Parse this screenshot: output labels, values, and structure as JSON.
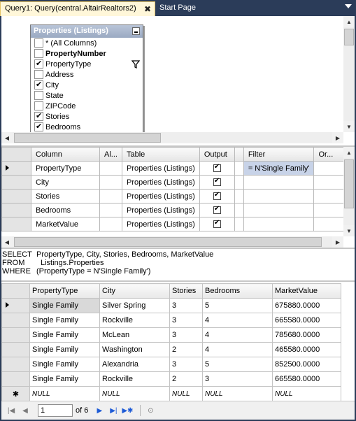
{
  "tabs": {
    "active_label": "Query1: Query(central.AltairRealtors2)",
    "close_glyph": "✖",
    "inactive_label": "Start Page"
  },
  "diagram": {
    "table_title": "Properties (Listings)",
    "columns": [
      {
        "label": "* (All Columns)",
        "checked": false,
        "bold": false
      },
      {
        "label": "PropertyNumber",
        "checked": false,
        "bold": true
      },
      {
        "label": "PropertyType",
        "checked": true,
        "bold": false,
        "filter_icon": "funnel-icon"
      },
      {
        "label": "Address",
        "checked": false,
        "bold": false
      },
      {
        "label": "City",
        "checked": true,
        "bold": false
      },
      {
        "label": "State",
        "checked": false,
        "bold": false
      },
      {
        "label": "ZIPCode",
        "checked": false,
        "bold": false
      },
      {
        "label": "Stories",
        "checked": true,
        "bold": false
      },
      {
        "label": "Bedrooms",
        "checked": true,
        "bold": false
      }
    ]
  },
  "criteria": {
    "headers": [
      "Column",
      "Al...",
      "Table",
      "Output",
      "",
      "Filter",
      "Or..."
    ],
    "rows": [
      {
        "column": "PropertyType",
        "alias": "",
        "table": "Properties (Listings)",
        "output": true,
        "filter": "= N'Single Family'"
      },
      {
        "column": "City",
        "alias": "",
        "table": "Properties (Listings)",
        "output": true,
        "filter": ""
      },
      {
        "column": "Stories",
        "alias": "",
        "table": "Properties (Listings)",
        "output": true,
        "filter": ""
      },
      {
        "column": "Bedrooms",
        "alias": "",
        "table": "Properties (Listings)",
        "output": true,
        "filter": ""
      },
      {
        "column": "MarketValue",
        "alias": "",
        "table": "Properties (Listings)",
        "output": true,
        "filter": ""
      }
    ]
  },
  "sql": {
    "select_kw": "SELECT",
    "select_text": "PropertyType, City, Stories, Bedrooms, MarketValue",
    "from_kw": "FROM",
    "from_text": "Listings.Properties",
    "where_kw": "WHERE",
    "where_text": "(PropertyType = N'Single Family')"
  },
  "results": {
    "headers": [
      "PropertyType",
      "City",
      "Stories",
      "Bedrooms",
      "MarketValue"
    ],
    "rows": [
      [
        "Single Family",
        "Silver Spring",
        "3",
        "5",
        "675880.0000"
      ],
      [
        "Single Family",
        "Rockville",
        "3",
        "4",
        "665580.0000"
      ],
      [
        "Single Family",
        "McLean",
        "3",
        "4",
        "785680.0000"
      ],
      [
        "Single Family",
        "Washington",
        "2",
        "4",
        "465580.0000"
      ],
      [
        "Single Family",
        "Alexandria",
        "3",
        "5",
        "852500.0000"
      ],
      [
        "Single Family",
        "Rockville",
        "2",
        "3",
        "665580.0000"
      ]
    ],
    "null_row": [
      "NULL",
      "NULL",
      "NULL",
      "NULL",
      "NULL"
    ],
    "new_row_glyph": "✱"
  },
  "navigator": {
    "current_page": "1",
    "of_text": "of 6"
  }
}
